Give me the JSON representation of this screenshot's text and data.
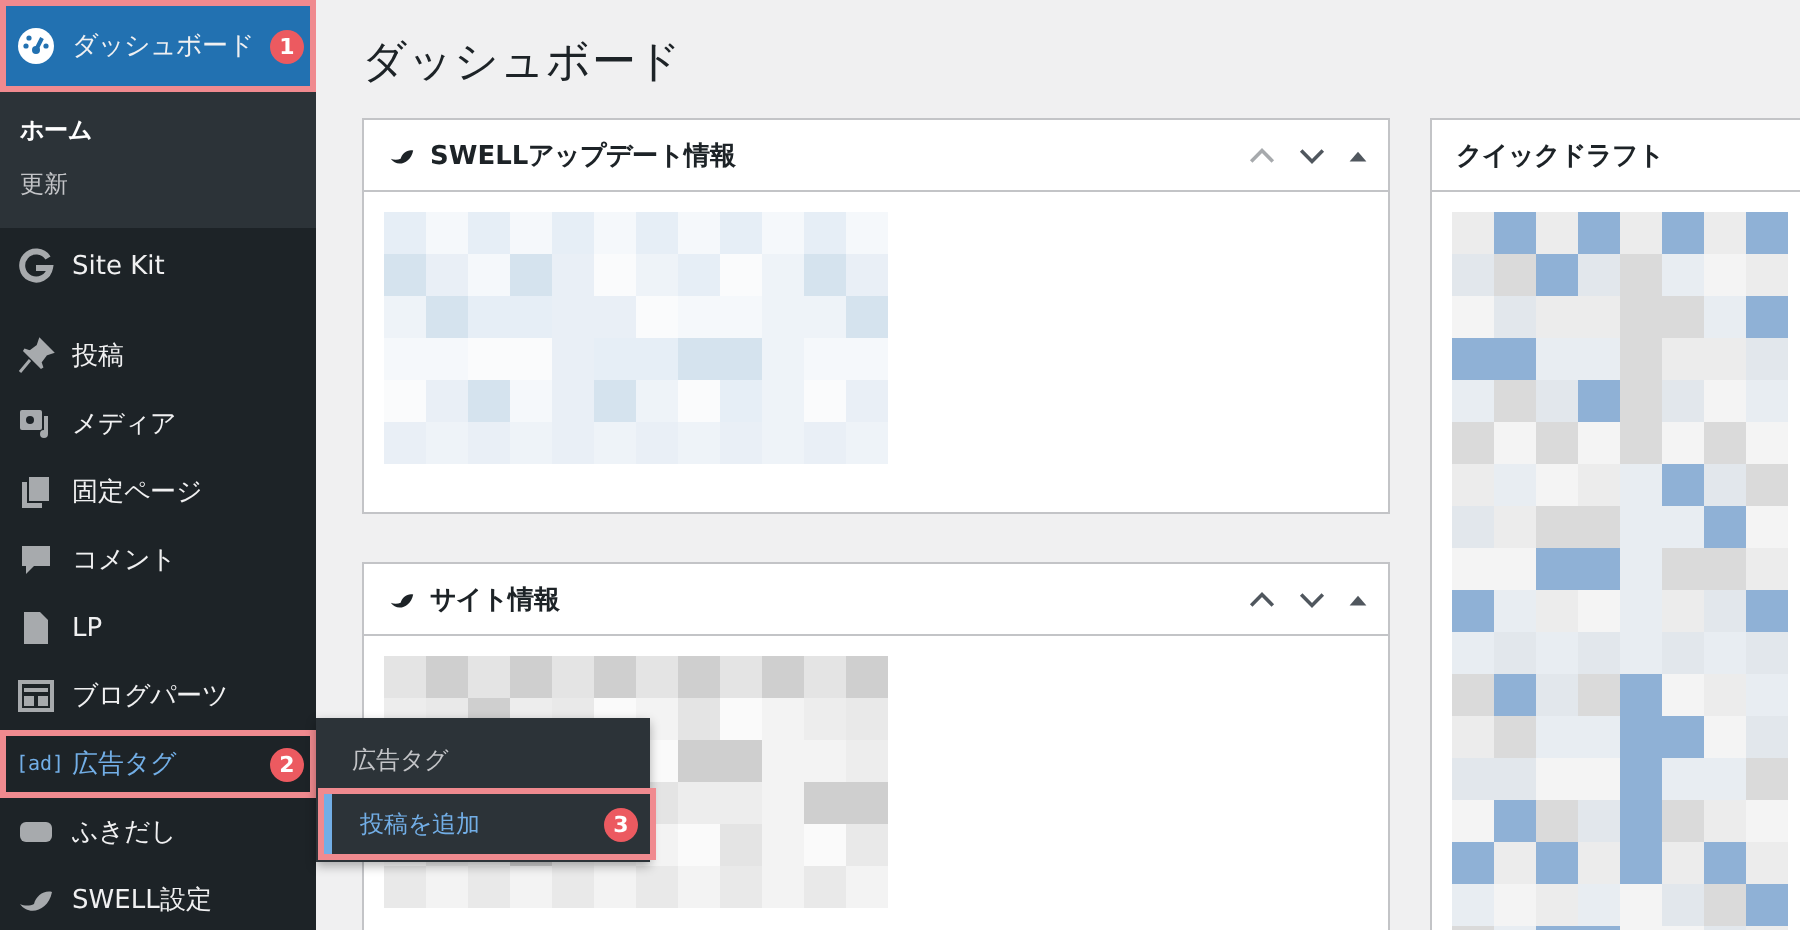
{
  "sidebar": {
    "items": [
      {
        "label": "ダッシュボード",
        "selected": true,
        "open": false,
        "badge": "1",
        "children": [
          {
            "label": "ホーム",
            "selected": true
          },
          {
            "label": "更新",
            "selected": false
          }
        ]
      },
      {
        "label": "Site Kit",
        "selected": false,
        "open": false
      },
      {
        "label": "投稿",
        "selected": false,
        "open": false
      },
      {
        "label": "メディア",
        "selected": false,
        "open": false
      },
      {
        "label": "固定ページ",
        "selected": false,
        "open": false
      },
      {
        "label": "コメント",
        "selected": false,
        "open": false
      },
      {
        "label": "LP",
        "selected": false,
        "open": false
      },
      {
        "label": "ブログパーツ",
        "selected": false,
        "open": false
      },
      {
        "label": "広告タグ",
        "icon_text": "[ad]",
        "selected": false,
        "open": true,
        "badge": "2",
        "flyout": {
          "items": [
            {
              "label": "広告タグ",
              "selected": false
            },
            {
              "label": "投稿を追加",
              "selected": true,
              "badge": "3"
            }
          ]
        }
      },
      {
        "label": "ふきだし",
        "selected": false,
        "open": false
      },
      {
        "label": "SWELL設定",
        "selected": false,
        "open": false
      }
    ]
  },
  "page_title": "ダッシュボード",
  "columns": [
    [
      {
        "title": "SWELLアップデート情報",
        "logo": true,
        "controls": true,
        "can_move_up": false
      },
      {
        "title": "サイト情報",
        "logo": true,
        "controls": true,
        "can_move_up": true
      }
    ],
    [
      {
        "title": "クイックドラフト",
        "logo": false,
        "controls": false
      }
    ]
  ]
}
